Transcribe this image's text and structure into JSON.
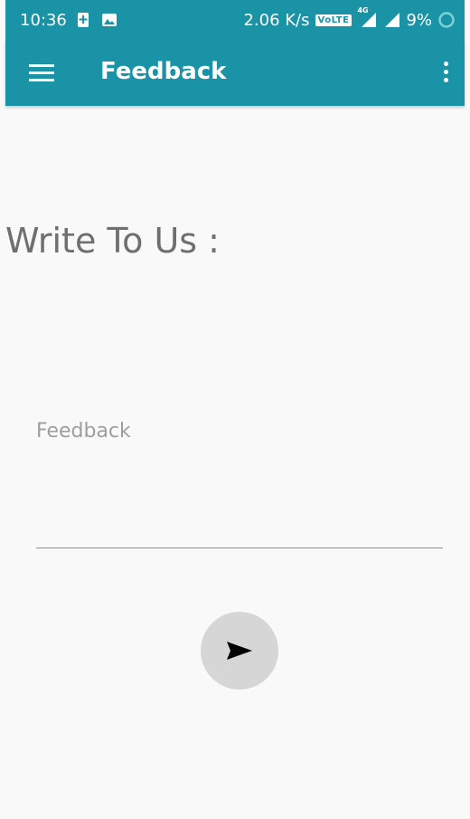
{
  "status_bar": {
    "time": "10:36",
    "speed": "2.06 K/s",
    "volte": "VoLTE",
    "network": "4G",
    "battery": "9%"
  },
  "app_bar": {
    "title": "Feedback"
  },
  "main": {
    "heading": "Write To Us :",
    "feedback_placeholder": "Feedback",
    "feedback_value": ""
  },
  "theme": {
    "accent": "#1a93a6",
    "fab_bg": "#d6d6d6"
  },
  "icons": {
    "menu": "hamburger-menu-icon",
    "more": "more-vert-icon",
    "send": "send-icon"
  }
}
